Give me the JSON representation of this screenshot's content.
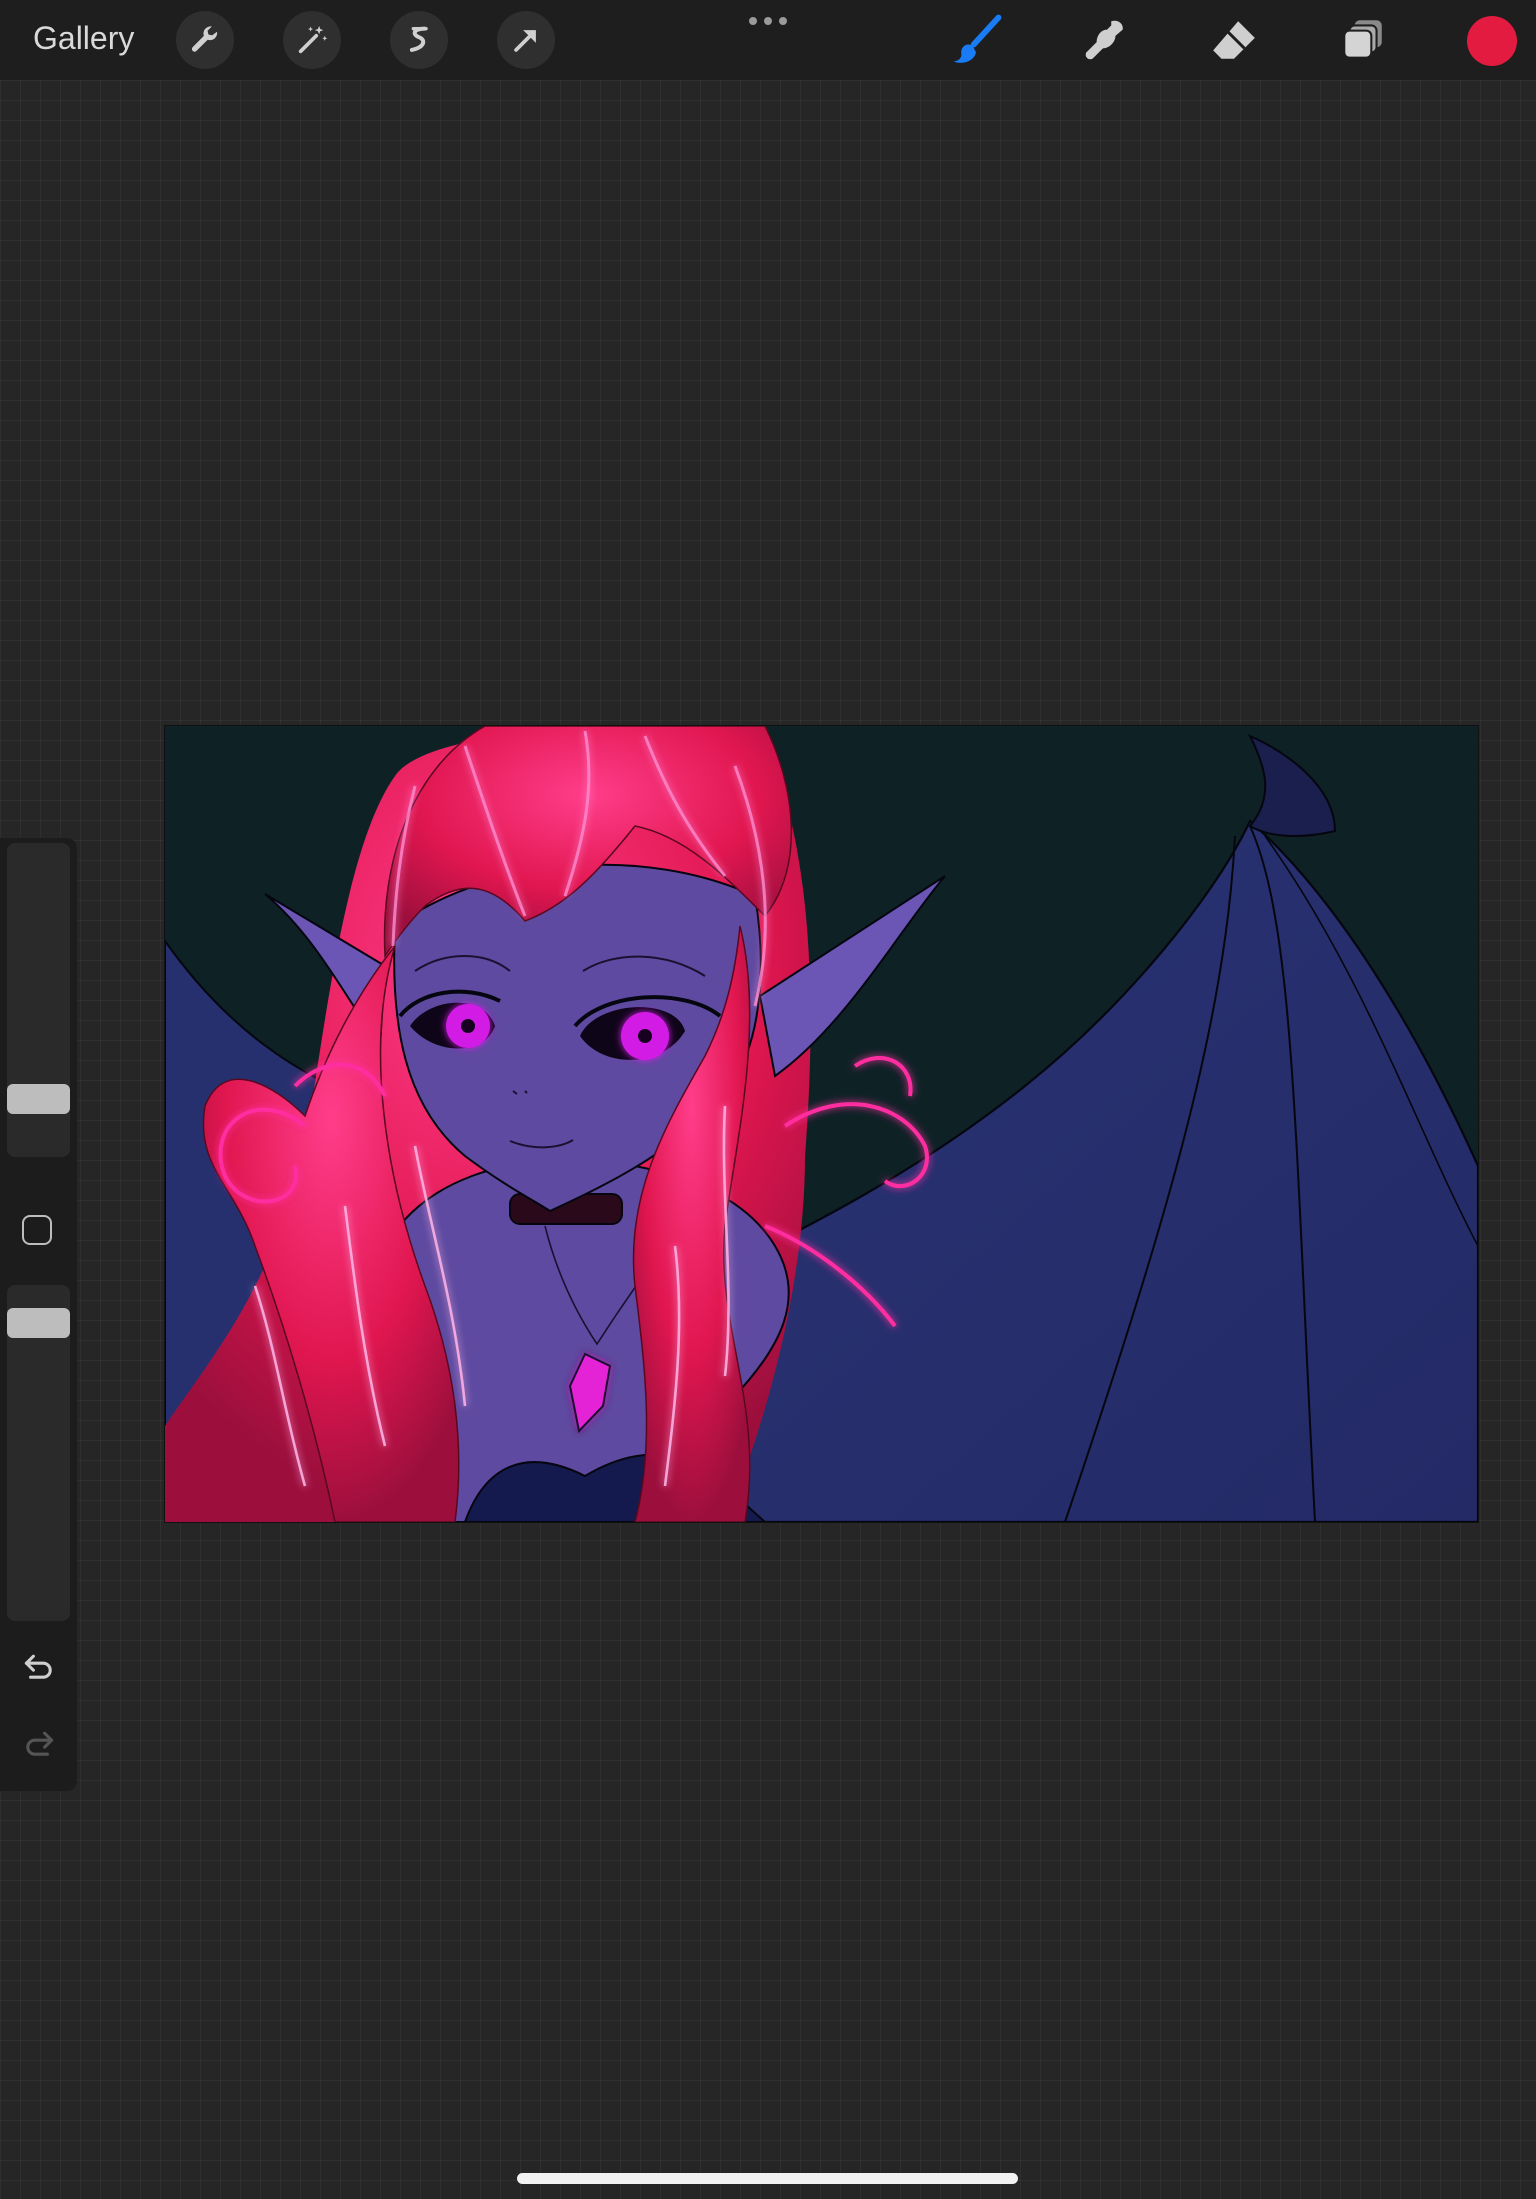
{
  "topbar": {
    "gallery_label": "Gallery",
    "left_tools": [
      "wrench-icon",
      "magic-wand-icon",
      "selection-icon",
      "transform-arrow-icon"
    ],
    "right_tools": [
      "brush-icon",
      "smudge-icon",
      "eraser-icon",
      "layers-icon"
    ],
    "active_tool": "brush-icon",
    "active_color": "#e31b40",
    "accent_color": "#1a7cf5"
  },
  "sidebar": {
    "brush_size": 0.8,
    "brush_opacity": 0.95
  },
  "canvas": {
    "background_color": "#0e2226",
    "skin_color": "#5e4aa0",
    "hair_color": "#e0164f",
    "wing_color": "#283072",
    "eye_color": "#d21ee6"
  }
}
